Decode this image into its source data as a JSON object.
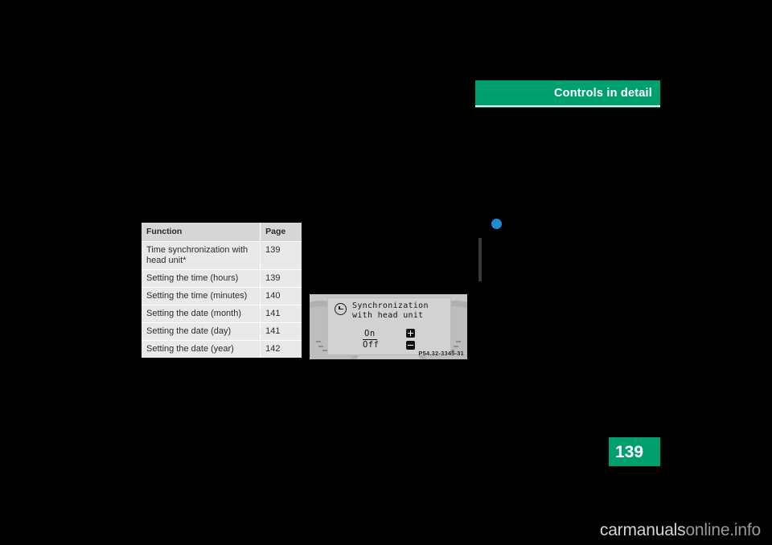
{
  "header": {
    "title": "Controls in detail"
  },
  "table": {
    "columns": [
      "Function",
      "Page"
    ],
    "rows": [
      {
        "function": "Time synchronization with head unit*",
        "page": "139"
      },
      {
        "function": "Setting the time (hours)",
        "page": "139"
      },
      {
        "function": "Setting the time (minutes)",
        "page": "140"
      },
      {
        "function": "Setting the date (month)",
        "page": "141"
      },
      {
        "function": "Setting the date (day)",
        "page": "141"
      },
      {
        "function": "Setting the date (year)",
        "page": "142"
      }
    ]
  },
  "illustration": {
    "display": {
      "title_line1": "Synchronization",
      "title_line2": "with head unit",
      "option_selected": "On",
      "option_other": "Off",
      "plus_label": "+",
      "minus_label": "–"
    },
    "figure_code": "P54.32-3345-31"
  },
  "page": {
    "number": "139"
  },
  "watermark": {
    "text_main": "carmanuals",
    "text_dim": "online.info"
  },
  "colors": {
    "accent_green": "#00a06e",
    "marker_blue": "#1f8ad2",
    "table_header_bg": "#d6d6d6",
    "table_row_bg": "#e9e9e9",
    "background": "#000000"
  }
}
